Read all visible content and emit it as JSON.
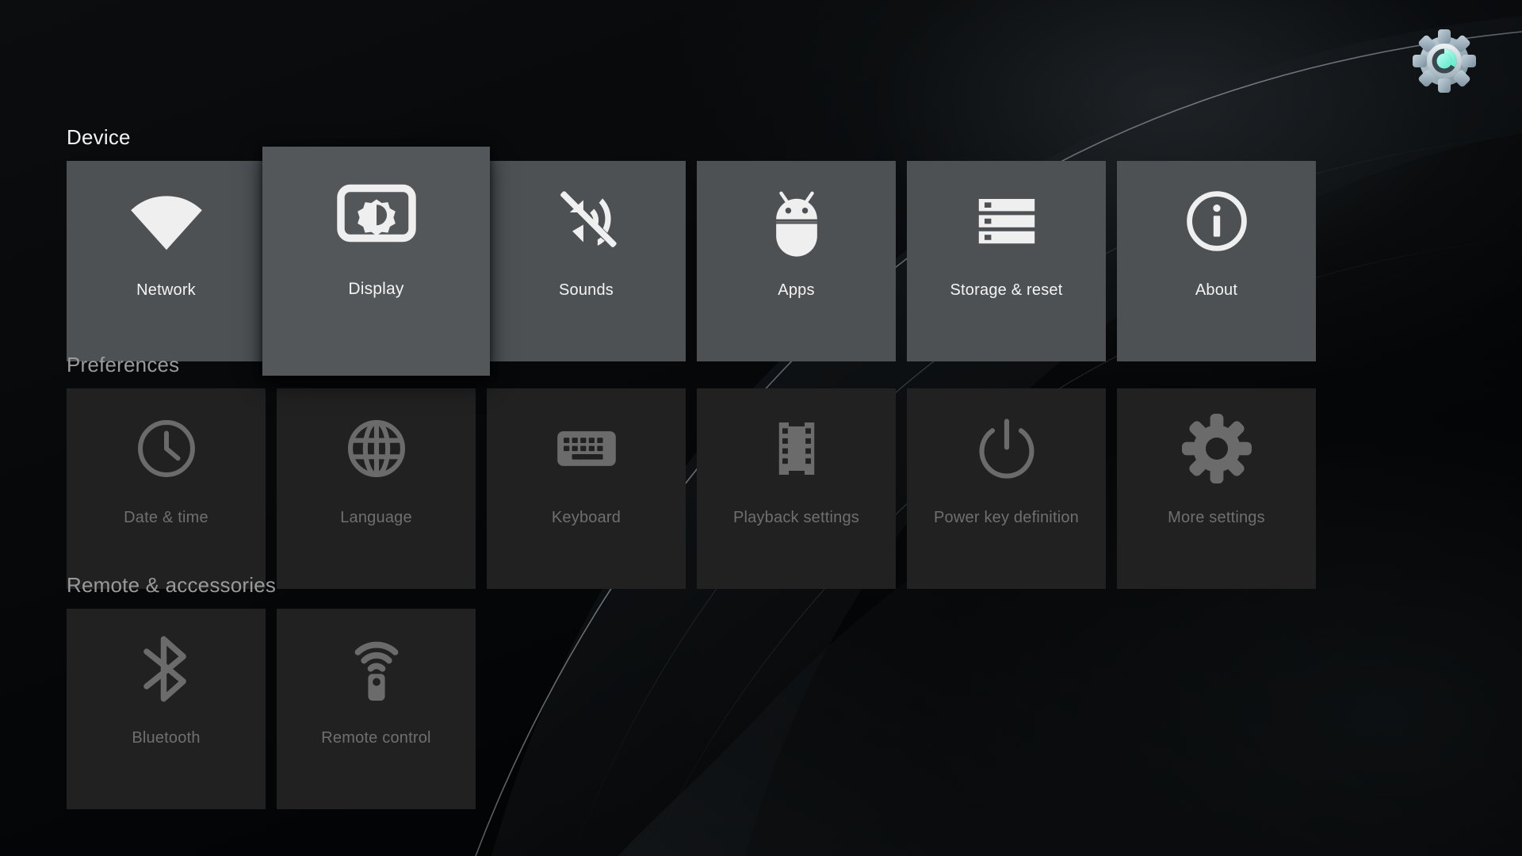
{
  "app": {
    "title": "Settings",
    "logo_icon": "settings-gear-logo",
    "logo_colors": {
      "body": "#a9bcc6",
      "accent": "#88f2dd",
      "ring": "#d8dee1"
    }
  },
  "theme": {
    "background": "#050708",
    "tile_active": "#4d5154",
    "tile_selected": "#53575a",
    "tile_dim": "#212121",
    "label_active": "#f4f4f4",
    "label_dim": "#6f6f6f",
    "heading_bright": "#f2f2f2",
    "heading_dim": "#9a9a9a",
    "icon_active": "#efefef",
    "icon_dim": "#6b6b6b"
  },
  "sections": [
    {
      "id": "device",
      "title": "Device",
      "state": "focused",
      "tiles": [
        {
          "label": "Network",
          "icon": "wifi-icon",
          "selected": false
        },
        {
          "label": "Display",
          "icon": "brightness-icon",
          "selected": true
        },
        {
          "label": "Sounds",
          "icon": "volume-off-icon",
          "selected": false
        },
        {
          "label": "Apps",
          "icon": "android-icon",
          "selected": false
        },
        {
          "label": "Storage & reset",
          "icon": "storage-icon",
          "selected": false
        },
        {
          "label": "About",
          "icon": "info-icon",
          "selected": false
        }
      ]
    },
    {
      "id": "preferences",
      "title": "Preferences",
      "state": "unfocused",
      "tiles": [
        {
          "label": "Date & time",
          "icon": "clock-icon",
          "selected": false
        },
        {
          "label": "Language",
          "icon": "globe-icon",
          "selected": false
        },
        {
          "label": "Keyboard",
          "icon": "keyboard-icon",
          "selected": false
        },
        {
          "label": "Playback settings",
          "icon": "film-icon",
          "selected": false
        },
        {
          "label": "Power key definition",
          "icon": "power-icon",
          "selected": false
        },
        {
          "label": "More settings",
          "icon": "gear-icon",
          "selected": false
        }
      ]
    },
    {
      "id": "remote",
      "title": "Remote & accessories",
      "state": "unfocused",
      "tiles": [
        {
          "label": "Bluetooth",
          "icon": "bluetooth-icon",
          "selected": false
        },
        {
          "label": "Remote control",
          "icon": "remote-icon",
          "selected": false
        }
      ]
    }
  ]
}
